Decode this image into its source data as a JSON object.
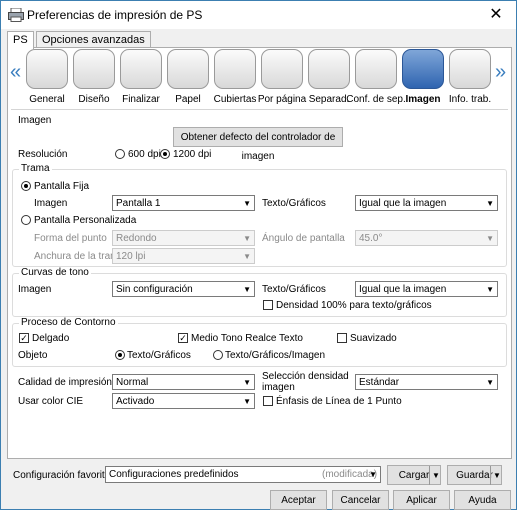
{
  "window": {
    "title": "Preferencias de impresión de PS",
    "close": "✕"
  },
  "tabs": [
    "PS",
    "Opciones avanzadas"
  ],
  "toolbar": {
    "items": [
      "General",
      "Diseño",
      "Finalizar",
      "Papel",
      "Cubiertas",
      "Por página",
      "Separad.",
      "Conf. de sep.",
      "Imagen",
      "Info. trab."
    ],
    "selected": "Imagen"
  },
  "imagen": {
    "section": "Imagen",
    "default_btn": "Obtener defecto del controlador de imagen",
    "resolution_label": "Resolución",
    "res_600": "600 dpi",
    "res_1200": "1200 dpi"
  },
  "trama": {
    "title": "Trama",
    "fixed": "Pantalla Fija",
    "image_label": "Imagen",
    "image_value": "Pantalla 1",
    "text_label": "Texto/Gráficos",
    "text_value": "Igual que la imagen",
    "custom": "Pantalla Personalizada",
    "dot_label": "Forma del punto",
    "dot_value": "Redondo",
    "angle_label": "Ángulo de pantalla",
    "angle_value": "45.0°",
    "width_label": "Anchura de la trama",
    "width_value": "120 lpi"
  },
  "curvas": {
    "title": "Curvas de tono",
    "image_label": "Imagen",
    "image_value": "Sin configuración",
    "text_label": "Texto/Gráficos",
    "text_value": "Igual que la imagen",
    "density": "Densidad 100% para texto/gráficos"
  },
  "contorno": {
    "title": "Proceso de Contorno",
    "thin": "Delgado",
    "halftone": "Medio Tono Realce Texto",
    "smooth": "Suavizado",
    "object_label": "Objeto",
    "obj_text": "Texto/Gráficos",
    "obj_textimg": "Texto/Gráficos/Imagen"
  },
  "misc": {
    "quality_label": "Calidad de impresión",
    "quality_value": "Normal",
    "density_sel_label_1": "Selección densidad",
    "density_sel_label_2": "imagen",
    "density_sel_value": "Estándar",
    "cie_label": "Usar color CIE",
    "cie_value": "Activado",
    "line_emphasis": "Énfasis de Línea de 1 Punto"
  },
  "fav": {
    "label": "Configuración favorita",
    "value": "Configuraciones predefinidos",
    "modified": "(modificada)",
    "load": "Cargar",
    "save": "Guardar"
  },
  "buttons": {
    "ok": "Aceptar",
    "cancel": "Cancelar",
    "apply": "Aplicar",
    "help": "Ayuda"
  }
}
